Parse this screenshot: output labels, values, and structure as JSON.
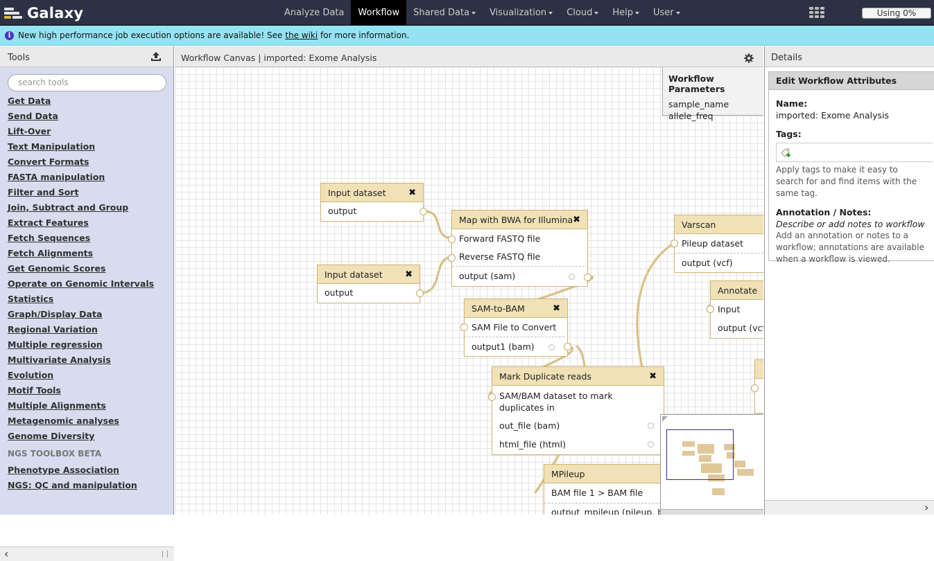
{
  "brand": {
    "title": "Galaxy"
  },
  "nav": [
    {
      "label": "Analyze Data",
      "active": false,
      "dropdown": false
    },
    {
      "label": "Workflow",
      "active": true,
      "dropdown": false
    },
    {
      "label": "Shared Data",
      "active": false,
      "dropdown": true
    },
    {
      "label": "Visualization",
      "active": false,
      "dropdown": true
    },
    {
      "label": "Cloud",
      "active": false,
      "dropdown": true
    },
    {
      "label": "Help",
      "active": false,
      "dropdown": true
    },
    {
      "label": "User",
      "active": false,
      "dropdown": true
    }
  ],
  "quota": {
    "label": "Using 0%"
  },
  "message": {
    "before": "New high performance job execution options are available! See",
    "link": "the wiki",
    "after": "for more information."
  },
  "tools": {
    "title": "Tools",
    "search_placeholder": "search tools",
    "items": [
      "Get Data",
      "Send Data",
      "Lift-Over",
      "Text Manipulation",
      "Convert Formats",
      "FASTA manipulation",
      "Filter and Sort",
      "Join, Subtract and Group",
      "Extract Features",
      "Fetch Sequences",
      "Fetch Alignments",
      "Get Genomic Scores",
      "Operate on Genomic Intervals",
      "Statistics",
      "Graph/Display Data",
      "Regional Variation",
      "Multiple regression",
      "Multivariate Analysis",
      "Evolution",
      "Motif Tools",
      "Multiple Alignments",
      "Metagenomic analyses",
      "Genome Diversity"
    ],
    "section_label": "NGS TOOLBOX BETA",
    "ngs_items": [
      "Phenotype Association",
      "NGS: QC and manipulation"
    ]
  },
  "canvas": {
    "title": "Workflow Canvas | imported: Exome Analysis",
    "params": {
      "heading": "Workflow Parameters",
      "values": [
        "sample_name",
        "allele_freq"
      ]
    },
    "nodes": {
      "input1": {
        "title": "Input dataset",
        "output": "output"
      },
      "input2": {
        "title": "Input dataset",
        "output": "output"
      },
      "bwa": {
        "title": "Map with BWA for Illumina",
        "in1": "Forward FASTQ file",
        "in2": "Reverse FASTQ file",
        "out": "output (sam)"
      },
      "samtobam": {
        "title": "SAM-to-BAM",
        "in1": "SAM File to Convert",
        "out": "output1 (bam)"
      },
      "markdup": {
        "title": "Mark Duplicate reads",
        "in1": "SAM/BAM dataset to mark duplicates in",
        "out1": "out_file (bam)",
        "out2": "html_file (html)"
      },
      "mpileup": {
        "title": "MPileup",
        "in1": "BAM file 1 > BAM file",
        "out": "output_mpileup (pileup, bc"
      },
      "varscan": {
        "title": "Varscan",
        "in1": "Pileup dataset",
        "out": "output (vcf)"
      },
      "annotate": {
        "title": "Annotate",
        "in1": "Input",
        "out": "output (vcf)"
      }
    }
  },
  "details": {
    "title": "Details",
    "box_title": "Edit Workflow Attributes",
    "name_label": "Name:",
    "name_value": "imported: Exome Analysis",
    "tags_label": "Tags:",
    "tags_help": "Apply tags to make it easy to search for and find items with the same tag.",
    "annotation_label": "Annotation / Notes:",
    "annotation_placeholder": "Describe or add notes to workflow",
    "annotation_help": "Add an annotation or notes to a workflow; annotations are available when a workflow is viewed."
  },
  "icons": {
    "upload": "upload-icon",
    "gear": "gear-icon",
    "grid": "app-grid-icon",
    "info": "info-icon",
    "tag_add": "tag-add-icon",
    "close": "close-icon"
  },
  "colors": {
    "masthead": "#2c3143",
    "message_bg": "#94e3f3",
    "tool_panel": "#d8dcee",
    "node_header": "#f1e1b6",
    "node_border": "#d2b676"
  }
}
